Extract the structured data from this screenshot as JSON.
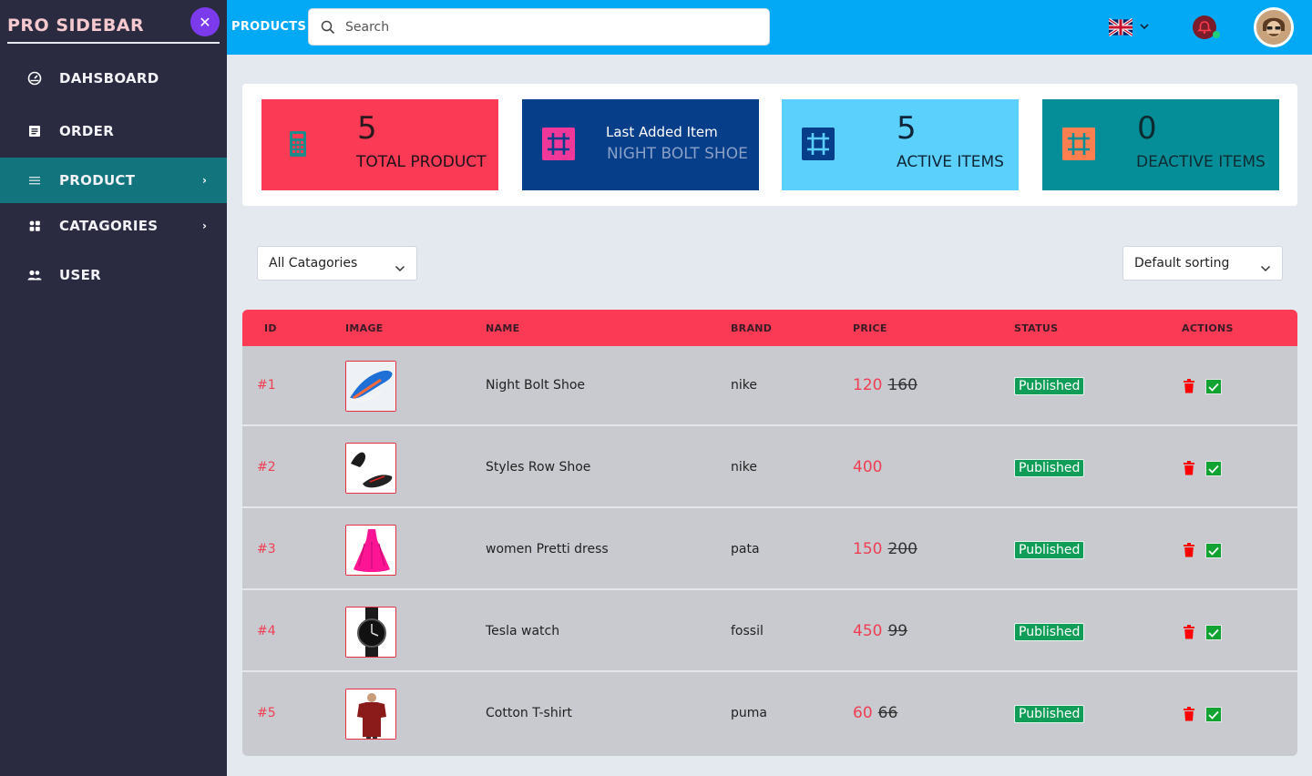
{
  "sidebar": {
    "brand": "PRO SIDEBAR",
    "close_icon": "close-icon",
    "items": [
      {
        "label": "DAHSBOARD",
        "icon": "dashboard-icon"
      },
      {
        "label": "ORDER",
        "icon": "order-icon"
      },
      {
        "label": "PRODUCT",
        "icon": "menu-icon",
        "active": true,
        "has_children": true
      },
      {
        "label": "CATAGORIES",
        "icon": "grid-icon",
        "has_children": true
      },
      {
        "label": "USER",
        "icon": "users-icon"
      }
    ],
    "chevron": "›"
  },
  "header": {
    "title": "PRODUCTS",
    "search_placeholder": "Search",
    "language_icon": "uk-flag-icon",
    "notification_icon": "bell-icon"
  },
  "stats": [
    {
      "value": "5",
      "label": "TOTAL PRODUCT",
      "color": "#fb3a55",
      "icon": "calculator-icon"
    },
    {
      "heading": "Last Added Item",
      "label": "NIGHT BOLT SHOE",
      "color": "#063e8a",
      "icon": "hash-icon"
    },
    {
      "value": "5",
      "label": "ACTIVE ITEMS",
      "color": "#5bd0fd",
      "icon": "hash-icon"
    },
    {
      "value": "0",
      "label": "DEACTIVE ITEMS",
      "color": "#068e98",
      "icon": "hash-icon"
    }
  ],
  "filters": {
    "category": "All Catagories",
    "sort": "Default sorting"
  },
  "table": {
    "columns": [
      "ID",
      "IMAGE",
      "NAME",
      "BRAND",
      "PRICE",
      "STATUS",
      "ACTIONS"
    ],
    "rows": [
      {
        "id": "#1",
        "name": "Night Bolt Shoe",
        "brand": "nike",
        "price": "120",
        "old_price": "160",
        "status": "Published",
        "image": "shoe-blue-image"
      },
      {
        "id": "#2",
        "name": "Styles Row Shoe",
        "brand": "nike",
        "price": "400",
        "old_price": "",
        "status": "Published",
        "image": "shoe-black-image"
      },
      {
        "id": "#3",
        "name": "women Pretti dress",
        "brand": "pata",
        "price": "150",
        "old_price": "200",
        "status": "Published",
        "image": "dress-pink-image"
      },
      {
        "id": "#4",
        "name": "Tesla watch",
        "brand": "fossil",
        "price": "450",
        "old_price": "99",
        "status": "Published",
        "image": "watch-black-image"
      },
      {
        "id": "#5",
        "name": "Cotton T-shirt",
        "brand": "puma",
        "price": "60",
        "old_price": "66",
        "status": "Published",
        "image": "tshirt-red-image"
      }
    ]
  },
  "colors": {
    "sidebar_bg": "#2a2b40",
    "active_bg": "#12747c",
    "topbar_bg": "#03a9f4",
    "table_header": "#fb3a55",
    "published": "#0f9d58"
  }
}
